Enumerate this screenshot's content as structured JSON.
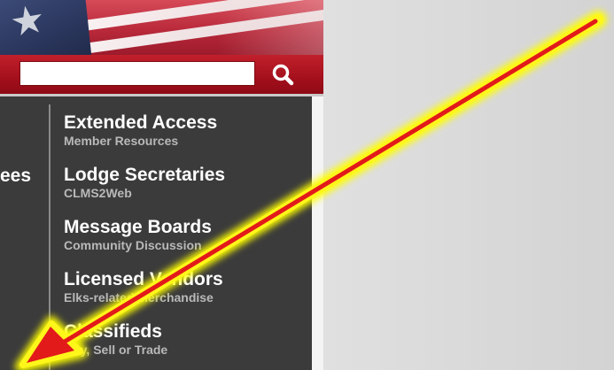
{
  "header": {
    "search": {
      "value": "",
      "placeholder": ""
    },
    "search_icon": "search-icon"
  },
  "menu": {
    "left_partial_label": "ees",
    "items": [
      {
        "title": "Extended Access",
        "subtitle": "Member Resources"
      },
      {
        "title": "Lodge Secretaries",
        "subtitle": "CLMS2Web"
      },
      {
        "title": "Message Boards",
        "subtitle": "Community Discussion"
      },
      {
        "title": "Licensed Vendors",
        "subtitle": "Elks-related Merchandise"
      },
      {
        "title": "Classifieds",
        "subtitle": "Buy, Sell or Trade"
      }
    ]
  },
  "annotation": {
    "type": "arrow",
    "colors": {
      "stroke": "#e21a1a",
      "glow": "#ffff00"
    }
  }
}
